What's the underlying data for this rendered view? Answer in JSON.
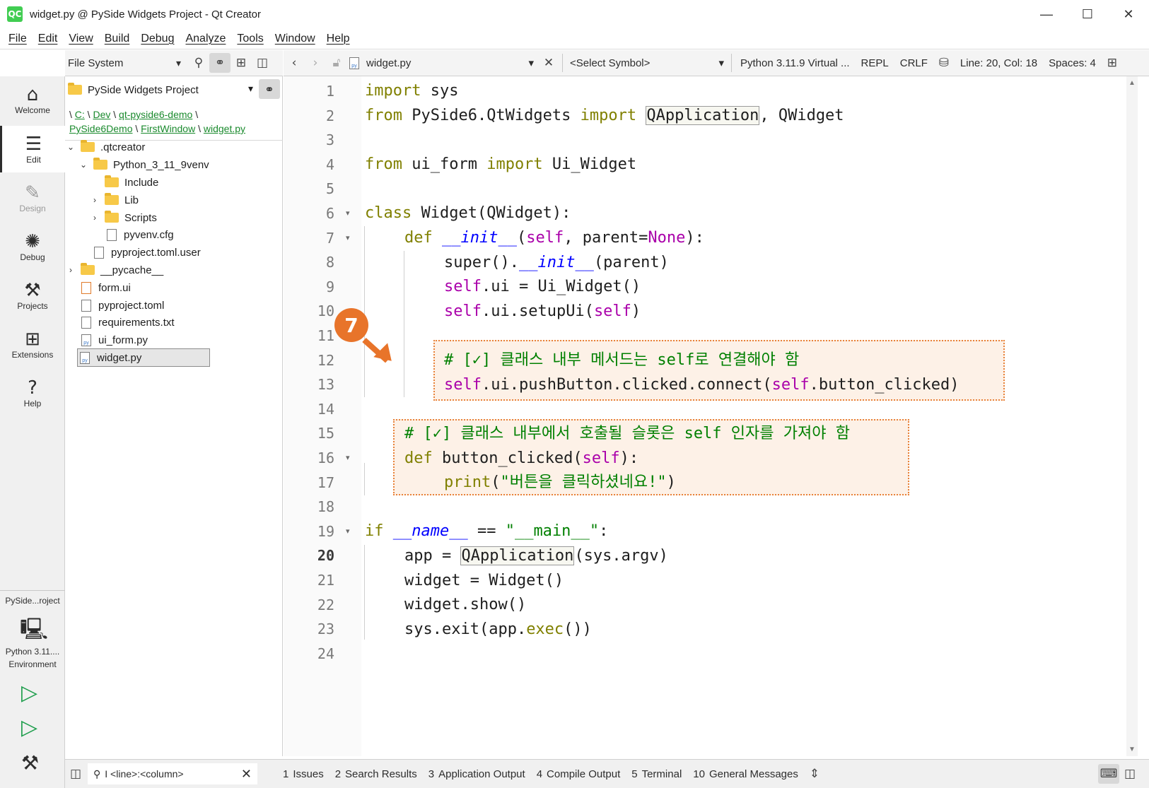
{
  "window": {
    "title": "widget.py @ PySide Widgets Project - Qt Creator",
    "logo_text": "QC",
    "minimize": "—",
    "maximize": "☐",
    "close": "✕"
  },
  "menu": [
    "File",
    "Edit",
    "View",
    "Build",
    "Debug",
    "Analyze",
    "Tools",
    "Window",
    "Help"
  ],
  "modes": [
    {
      "label": "Welcome",
      "icon": "home-icon",
      "glyph": "⌂"
    },
    {
      "label": "Edit",
      "icon": "edit-icon",
      "glyph": "☰",
      "active": true
    },
    {
      "label": "Design",
      "icon": "design-icon",
      "glyph": "✎",
      "disabled": true
    },
    {
      "label": "Debug",
      "icon": "debug-icon",
      "glyph": "✺"
    },
    {
      "label": "Projects",
      "icon": "wrench-icon",
      "glyph": "⚒"
    },
    {
      "label": "Extensions",
      "icon": "extensions-icon",
      "glyph": "⊞"
    },
    {
      "label": "Help",
      "icon": "help-icon",
      "glyph": "?"
    }
  ],
  "kit": {
    "project": "PySide...roject",
    "env_line1": "Python 3.11....",
    "env_line2": "Environment"
  },
  "sidebar_toolbar": {
    "view": "File System"
  },
  "project_panel": {
    "project_name": "PySide Widgets Project",
    "breadcrumb": {
      "prefix": "\\",
      "parts": [
        "C:",
        "Dev",
        "qt-pyside6-demo",
        "PySide6Demo",
        "FirstWindow",
        "widget.py"
      ],
      "sep": "\\"
    },
    "tree": [
      {
        "name": ".qtcreator",
        "type": "folder",
        "depth": 0,
        "expanded": true
      },
      {
        "name": "Python_3_11_9venv",
        "type": "folder",
        "depth": 1,
        "expanded": true
      },
      {
        "name": "Include",
        "type": "folder",
        "depth": 2
      },
      {
        "name": "Lib",
        "type": "folder",
        "depth": 2,
        "collapsed": true
      },
      {
        "name": "Scripts",
        "type": "folder",
        "depth": 2,
        "collapsed": true
      },
      {
        "name": "pyvenv.cfg",
        "type": "file",
        "depth": 2
      },
      {
        "name": "pyproject.toml.user",
        "type": "file",
        "depth": 1
      },
      {
        "name": "__pycache__",
        "type": "folder",
        "depth": 0,
        "collapsed": true
      },
      {
        "name": "form.ui",
        "type": "file",
        "depth": 0
      },
      {
        "name": "pyproject.toml",
        "type": "file",
        "depth": 0
      },
      {
        "name": "requirements.txt",
        "type": "file",
        "depth": 0
      },
      {
        "name": "ui_form.py",
        "type": "file",
        "depth": 0
      },
      {
        "name": "widget.py",
        "type": "file",
        "depth": 0,
        "selected": true
      }
    ]
  },
  "editor_toolbar": {
    "file": "widget.py",
    "symbol": "<Select Symbol>",
    "interpreter": "Python 3.11.9 Virtual ...",
    "repl": "REPL",
    "line_ending": "CRLF",
    "position": "Line: 20, Col: 18",
    "spaces": "Spaces: 4"
  },
  "editor": {
    "current_line": 20,
    "line_numbers": [
      "1",
      "2",
      "3",
      "4",
      "5",
      "6",
      "7",
      "8",
      "9",
      "10",
      "11",
      "12",
      "13",
      "14",
      "15",
      "16",
      "17",
      "18",
      "19",
      "20",
      "21",
      "22",
      "23",
      "24"
    ],
    "callout_number": "7",
    "lines": {
      "l1_kw": "import",
      "l1_rest": " sys",
      "l2_kw1": "from",
      "l2_mod": " PySide6.QtWidgets ",
      "l2_kw2": "import",
      "l2_sp": " ",
      "l2_hl": "QApplication",
      "l2_rest": ", QWidget",
      "l4_kw1": "from",
      "l4_mod": " ui_form ",
      "l4_kw2": "import",
      "l4_rest": " Ui_Widget",
      "l6_kw": "class",
      "l6_rest": " Widget(QWidget):",
      "l7_kw": "def",
      "l7_sp": " ",
      "l7_magic": "__init__",
      "l7_p1": "(",
      "l7_self": "self",
      "l7_p2": ", parent=",
      "l7_none": "None",
      "l7_p3": "):",
      "l8_a": "super().",
      "l8_magic": "__init__",
      "l8_b": "(parent)",
      "l9_self": "self",
      "l9_rest": ".ui = Ui_Widget()",
      "l10_self": "self",
      "l10_a": ".ui.setupUi(",
      "l10_self2": "self",
      "l10_b": ")",
      "l12_comment": "# [✓] 클래스 내부 메서드는 self로 연결해야 함",
      "l13_self": "self",
      "l13_a": ".ui.pushButton.clicked.connect(",
      "l13_self2": "self",
      "l13_b": ".button_clicked)",
      "l15_comment": "# [✓] 클래스 내부에서 호출될 슬롯은 self 인자를 가져야 함",
      "l16_kw": "def",
      "l16_a": " button_clicked(",
      "l16_self": "self",
      "l16_b": "):",
      "l17_bi": "print",
      "l17_a": "(",
      "l17_str": "\"버튼을 클릭하셨네요!\"",
      "l17_b": ")",
      "l19_kw": "if",
      "l19_sp": " ",
      "l19_magic": "__name__",
      "l19_eq": " == ",
      "l19_str": "\"__main__\"",
      "l19_c": ":",
      "l20_a": "app = ",
      "l20_hl": "QApplication",
      "l20_b": "(sys.argv)",
      "l21": "widget = Widget()",
      "l22": "widget.show()",
      "l23_a": "sys.exit(app.",
      "l23_bi": "exec",
      "l23_b": "())"
    }
  },
  "bottom": {
    "locator_placeholder": "I <line>:<column>",
    "tabs": [
      {
        "n": "1",
        "label": "Issues"
      },
      {
        "n": "2",
        "label": "Search Results"
      },
      {
        "n": "3",
        "label": "Application Output"
      },
      {
        "n": "4",
        "label": "Compile Output"
      },
      {
        "n": "5",
        "label": "Terminal"
      },
      {
        "n": "10",
        "label": "General Messages"
      }
    ]
  },
  "colors": {
    "accent_orange": "#e8742a",
    "keyword": "#808000",
    "comment": "#008000",
    "self": "#aa00aa",
    "link": "#1a8a2d"
  }
}
